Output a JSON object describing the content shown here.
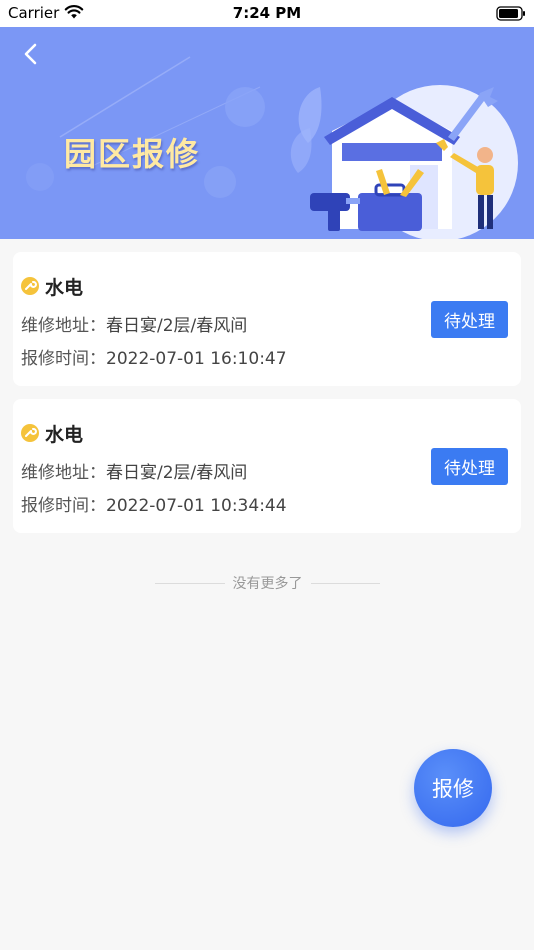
{
  "status_bar": {
    "carrier": "Carrier",
    "time": "7:24 PM"
  },
  "header": {
    "title": "园区报修",
    "back_icon": "chevron-left-icon",
    "banner_color": "#7b97f5"
  },
  "repairs": [
    {
      "type": "水电",
      "address_label": "维修地址：",
      "address": "春日宴/2层/春风间",
      "time_label": "报修时间：",
      "time": "2022-07-01 16:10:47",
      "status": "待处理"
    },
    {
      "type": "水电",
      "address_label": "维修地址：",
      "address": "春日宴/2层/春风间",
      "time_label": "报修时间：",
      "time": "2022-07-01 10:34:44",
      "status": "待处理"
    }
  ],
  "list_end_text": "没有更多了",
  "fab_label": "报修",
  "colors": {
    "accent": "#3b7bf2",
    "type_icon": "#f5c33b",
    "title_text": "#ffe9a3"
  }
}
